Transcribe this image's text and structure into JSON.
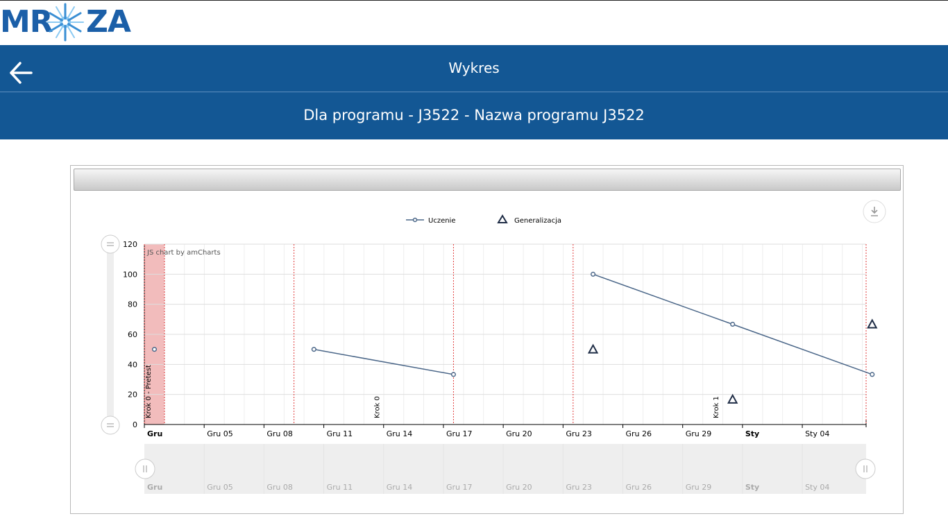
{
  "app": {
    "logo_text_left": "MR",
    "logo_text_right": "ZA",
    "page_title": "Wykres",
    "subtitle": "Dla programu - J3522 - Nazwa programu J3522",
    "back_icon": "arrow-left-icon"
  },
  "colors": {
    "header": "#135794",
    "series_line": "#4a6688",
    "generalization_marker": "#1f2d46",
    "pretest_band": "#f2bcbc",
    "guide_line": "#e03a3a"
  },
  "chart_data": {
    "type": "line",
    "credit": "JS chart by amCharts",
    "ylim": [
      0,
      120
    ],
    "y_ticks": [
      "0",
      "20",
      "40",
      "60",
      "80",
      "100",
      "120"
    ],
    "x_range": [
      "2019-12-01",
      "2020-01-06"
    ],
    "x_ticks": [
      {
        "date": "2019-12-02",
        "label": "Gru",
        "bold": true
      },
      {
        "date": "2019-12-05",
        "label": "Gru 05",
        "bold": false
      },
      {
        "date": "2019-12-08",
        "label": "Gru 08",
        "bold": false
      },
      {
        "date": "2019-12-11",
        "label": "Gru 11",
        "bold": false
      },
      {
        "date": "2019-12-14",
        "label": "Gru 14",
        "bold": false
      },
      {
        "date": "2019-12-17",
        "label": "Gru 17",
        "bold": false
      },
      {
        "date": "2019-12-20",
        "label": "Gru 20",
        "bold": false
      },
      {
        "date": "2019-12-23",
        "label": "Gru 23",
        "bold": false
      },
      {
        "date": "2019-12-26",
        "label": "Gru 26",
        "bold": false
      },
      {
        "date": "2019-12-29",
        "label": "Gru 29",
        "bold": false
      },
      {
        "date": "2020-01-01",
        "label": "Sty",
        "bold": true
      },
      {
        "date": "2020-01-04",
        "label": "Sty 04",
        "bold": false
      }
    ],
    "legend": [
      {
        "name": "Uczenie",
        "marker": "line-circle"
      },
      {
        "name": "Generalizacja",
        "marker": "triangle"
      }
    ],
    "series": [
      {
        "name": "Uczenie",
        "segments": [
          [
            {
              "x": "2019-12-01",
              "y": 50
            }
          ],
          [
            {
              "x": "2019-12-09",
              "y": 50
            },
            {
              "x": "2019-12-16",
              "y": 33.3
            }
          ],
          [
            {
              "x": "2019-12-23",
              "y": 100
            },
            {
              "x": "2019-12-30",
              "y": 66.7
            },
            {
              "x": "2020-01-06",
              "y": 33.3
            }
          ]
        ]
      },
      {
        "name": "Generalizacja",
        "points": [
          {
            "x": "2019-12-23",
            "y": 50
          },
          {
            "x": "2019-12-30",
            "y": 16.7
          },
          {
            "x": "2020-01-06",
            "y": 66.7
          }
        ]
      }
    ],
    "guides": [
      {
        "date": "2019-12-01",
        "label": "Krok 0 - Pretest"
      },
      {
        "date": "2019-12-08",
        "label": ""
      },
      {
        "date": "2019-12-16",
        "label": ""
      },
      {
        "date": "2019-12-22",
        "label": ""
      },
      {
        "date": "2020-01-06",
        "label": ""
      }
    ],
    "pretest_band": [
      "2019-12-01",
      "2019-12-02"
    ],
    "phase_labels": [
      {
        "date": "2019-12-12",
        "label": "Krok 0"
      },
      {
        "date": "2019-12-29",
        "label": "Krok 1"
      }
    ],
    "grid": true,
    "legend_position": "top-center",
    "scrollbar": true
  }
}
